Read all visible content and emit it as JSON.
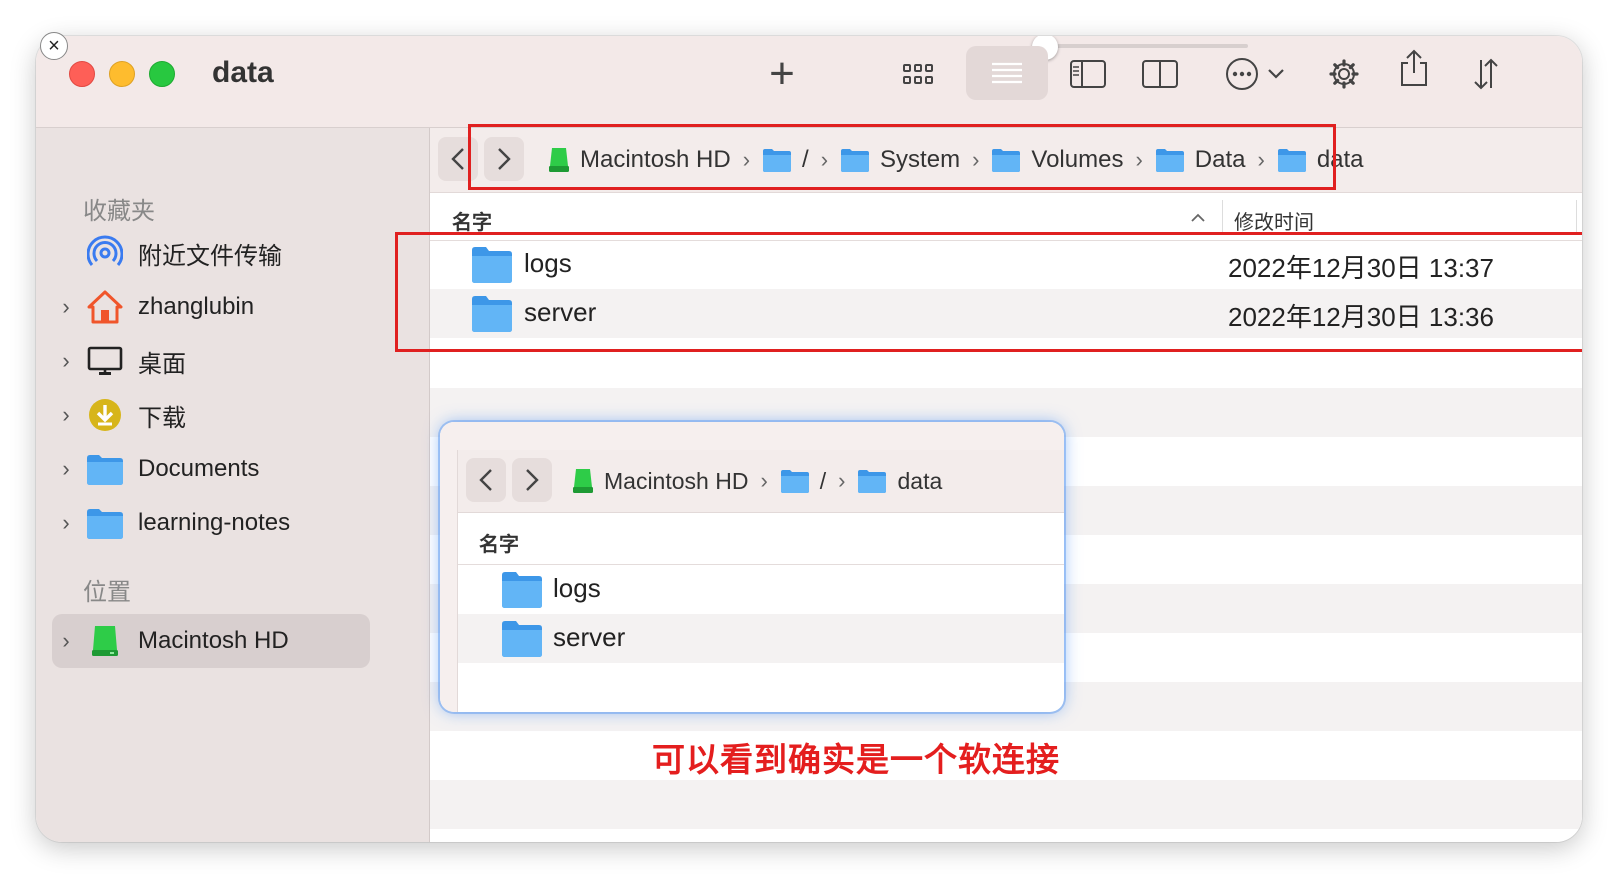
{
  "window": {
    "title": "data"
  },
  "toolbar": {
    "add_symbol": "+",
    "more_symbol": "⋯"
  },
  "sidebar": {
    "section_favorites": "收藏夹",
    "section_locations": "位置",
    "items": [
      {
        "label": "附近文件传输",
        "icon": "airdrop-icon",
        "has_chevron": false
      },
      {
        "label": "zhanglubin",
        "icon": "home-icon",
        "has_chevron": true
      },
      {
        "label": "桌面",
        "icon": "desktop-icon",
        "has_chevron": true
      },
      {
        "label": "下载",
        "icon": "download-icon",
        "has_chevron": true
      },
      {
        "label": "Documents",
        "icon": "folder-icon",
        "has_chevron": true
      },
      {
        "label": "learning-notes",
        "icon": "folder-icon",
        "has_chevron": true
      }
    ],
    "locations": [
      {
        "label": "Macintosh HD",
        "icon": "disk-icon",
        "selected": true
      }
    ]
  },
  "pathbar": {
    "crumbs": [
      "Macintosh HD",
      "/",
      "System",
      "Volumes",
      "Data",
      "data"
    ]
  },
  "list": {
    "col_name": "名字",
    "col_modified": "修改时间",
    "sort_indicator": "^",
    "rows": [
      {
        "name": "logs",
        "modified": "2022年12月30日 13:37"
      },
      {
        "name": "server",
        "modified": "2022年12月30日 13:36"
      }
    ]
  },
  "inset": {
    "crumbs": [
      "Macintosh HD",
      "/",
      "data"
    ],
    "col_name": "名字",
    "rows": [
      {
        "name": "logs"
      },
      {
        "name": "server"
      }
    ]
  },
  "caption": "可以看到确实是一个软连接",
  "colors": {
    "highlight": "#e02020",
    "folder": "#5aaef2",
    "disk": "#2ecc48",
    "caption": "#e41e1e"
  }
}
